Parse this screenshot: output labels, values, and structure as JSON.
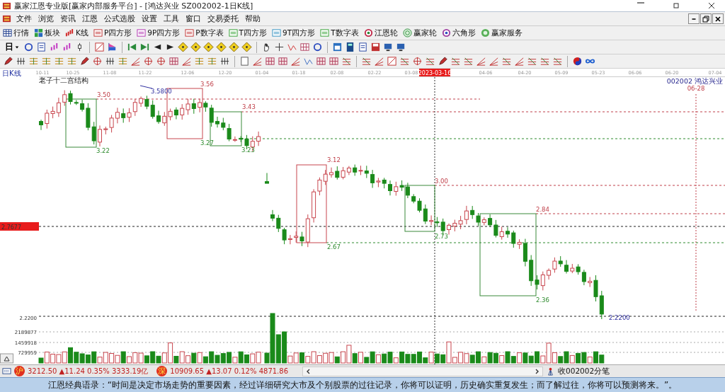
{
  "window": {
    "title": "赢家江恩专业版[赢家内部服务平台] - [鸿达兴业  SZ002002-1日K线]"
  },
  "menu": {
    "items": [
      "文件",
      "浏览",
      "资讯",
      "江恩",
      "公式选股",
      "设置",
      "工具",
      "窗口",
      "交易委托",
      "帮助"
    ]
  },
  "toolbar": {
    "buttons": [
      {
        "label": "行情",
        "kind": "quotes"
      },
      {
        "label": "板块",
        "kind": "blocks"
      },
      {
        "label": "K线",
        "kind": "kline"
      },
      {
        "label": "P四方形",
        "kind": "p-square"
      },
      {
        "label": "9P四方形",
        "kind": "p9-square"
      },
      {
        "label": "P数字表",
        "kind": "p-table"
      },
      {
        "label": "T四方形",
        "kind": "t-square"
      },
      {
        "label": "9T四方形",
        "kind": "t9-square"
      },
      {
        "label": "T数字表",
        "kind": "t-table"
      },
      {
        "label": "江恩轮",
        "kind": "gann-wheel"
      },
      {
        "label": "赢家轮",
        "kind": "winner-wheel"
      },
      {
        "label": "六角形",
        "kind": "hexagon"
      },
      {
        "label": "赢家服务",
        "kind": "service"
      }
    ]
  },
  "period_selector": {
    "value": "日"
  },
  "chart": {
    "period_label": "日K线",
    "title": "老子十二宫结构",
    "dates": [
      "10-11",
      "10-25",
      "11-08",
      "11-22",
      "12-06",
      "12-20",
      "01-04",
      "01-18",
      "02-08",
      "02-22",
      "03-08",
      "04-06",
      "04-20",
      "05-09",
      "05-23",
      "06-06",
      "06-20",
      "07-04"
    ],
    "cursor_date": "2023-03-16",
    "stock": {
      "code": "002002",
      "name": "鸿达兴业"
    },
    "marker_date": "06-28",
    "current_price": "2.7677",
    "price_labels": [
      {
        "text": "3.50",
        "kind": "high"
      },
      {
        "text": "3.5800",
        "kind": "extreme"
      },
      {
        "text": "3.56",
        "kind": "high"
      },
      {
        "text": "3.43",
        "kind": "high"
      },
      {
        "text": "3.22",
        "kind": "low"
      },
      {
        "text": "3.27",
        "kind": "low"
      },
      {
        "text": "3.23",
        "kind": "low"
      },
      {
        "text": "3.12",
        "kind": "high"
      },
      {
        "text": "2.67",
        "kind": "low"
      },
      {
        "text": "3.00",
        "kind": "high"
      },
      {
        "text": "2.73",
        "kind": "low"
      },
      {
        "text": "2.84",
        "kind": "high"
      },
      {
        "text": "2.36",
        "kind": "low"
      },
      {
        "text": "2.2200",
        "kind": "extreme"
      }
    ],
    "volume_axis": [
      "2.2200",
      "2189877",
      "1459918",
      "729959"
    ]
  },
  "status_bar": {
    "indices": [
      {
        "badge": "沪",
        "value": "3212.50",
        "change": "▲11.24",
        "percent": "0.35%",
        "amount": "3333.19亿"
      },
      {
        "badge": "深",
        "value": "10909.65",
        "change": "▲13.07",
        "percent": "0.12%",
        "amount": "4871.86"
      }
    ],
    "ticker": "收002002分笔"
  },
  "quote": "江恩经典语录：“时间是决定市场走势的重要因素，经过详细研究大市及个别股票的过往记录，你将可以证明，历史确实重复发生；而了解过往，你将可以预测将来。”。"
}
